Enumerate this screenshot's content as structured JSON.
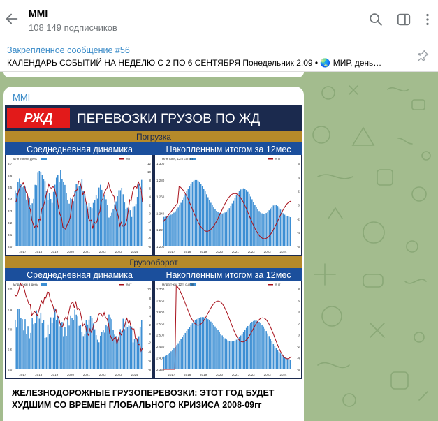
{
  "header": {
    "channel_name": "MMI",
    "subscribers": "108 149 подписчиков"
  },
  "pinned": {
    "title": "Закреплённое сообщение #56",
    "text": "КАЛЕНДАРЬ СОБЫТИЙ НА НЕДЕЛЮ С 2 ПО 6 СЕНТЯБРЯ  Понедельник 2.09 • 🌏 МИР, день…"
  },
  "message": {
    "sender": "MMI",
    "infographic": {
      "logo_text": "РЖД",
      "main_title": "ПЕРЕВОЗКИ ГРУЗОВ ПО ЖД",
      "section1": "Погрузка",
      "section2": "Грузооборот",
      "panel_daily": "Среднедневная динамика",
      "panel_cumulative": "Накопленным итогом за 12мес",
      "legend1_bar": "млн тонн в день",
      "legend1_pct": "% гг",
      "legend2_bar": "млн тонн, 12m cumm",
      "legend2_pct": "% гг",
      "legend3_bar": "млрд т-км в день",
      "legend3_pct": "% гг",
      "legend4_bar": "млрд т-км, 12m cumm",
      "legend4_pct": "% гг",
      "years": [
        "2017",
        "2018",
        "2019",
        "2020",
        "2021",
        "2022",
        "2023",
        "2024"
      ],
      "c1_left": [
        "3,7",
        "3,6",
        "3,5",
        "3,4",
        "3,3",
        "3,2",
        "3,1",
        "3,0"
      ],
      "c1_right": [
        "12",
        "10",
        "8",
        "6",
        "4",
        "2",
        "0",
        "-2",
        "-4",
        "-6",
        "-8"
      ],
      "c2_left": [
        "1 300",
        "1 280",
        "1 260",
        "1 240",
        "1 220",
        "1 200"
      ],
      "c2_right": [
        "6",
        "4",
        "2",
        "0",
        "-2",
        "-4",
        "-6"
      ],
      "c3_left": [
        "8,0",
        "7,5",
        "7,0",
        "6,5",
        "6,0"
      ],
      "c3_right": [
        "10",
        "8",
        "6",
        "4",
        "2",
        "0",
        "-2",
        "-4",
        "-6",
        "-8"
      ],
      "c4_left": [
        "2 700",
        "2 650",
        "2 600",
        "2 550",
        "2 500",
        "2 450",
        "2 400",
        "2 350"
      ],
      "c4_right": [
        "8",
        "6",
        "4",
        "2",
        "0",
        "-2",
        "-4",
        "-6"
      ]
    },
    "caption_link": "ЖЕЛЕЗНОДОРОЖНЫЕ ГРУЗОПЕРЕВОЗКИ",
    "caption_rest": ": ЭТОТ ГОД БУДЕТ ХУДШИМ СО ВРЕМЕН ГЛОБАЛЬНОГО КРИЗИСА 2008-09гг"
  },
  "colors": {
    "bar": "#3d8fd4",
    "line": "#a8101a",
    "banner": "#1b2a4e",
    "section": "#b58a2a",
    "rzd_red": "#e21a1a"
  },
  "icons": [
    "back-arrow-icon",
    "search-icon",
    "sidebar-toggle-icon",
    "more-icon",
    "unpin-icon"
  ]
}
